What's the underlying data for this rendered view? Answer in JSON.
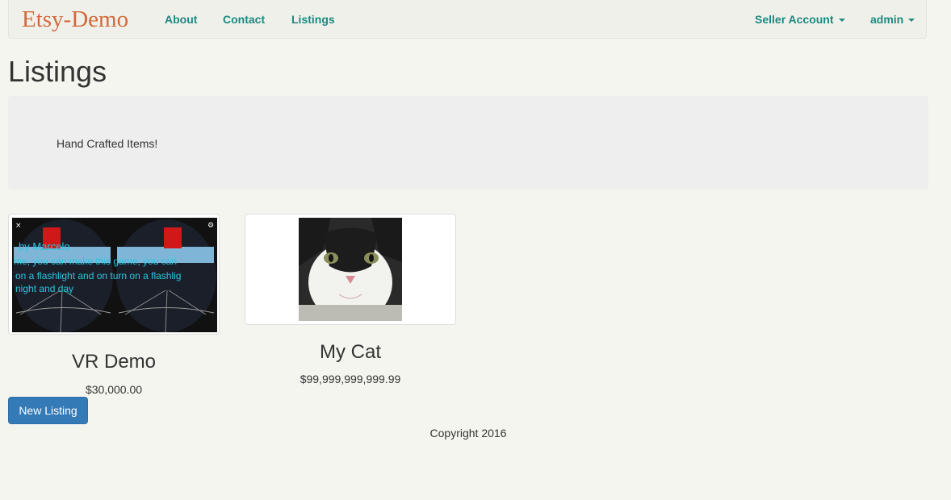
{
  "navbar": {
    "brand": "Etsy-Demo",
    "links": [
      "About",
      "Contact",
      "Listings"
    ],
    "seller_account": "Seller Account",
    "user": "admin"
  },
  "page": {
    "title": "Listings",
    "tagline": "Hand Crafted Items!"
  },
  "listings": [
    {
      "title": "VR Demo",
      "price": "$30,000.00",
      "image_text": [
        "by Marcelo",
        "me, you can make this game, you can",
        "on a flashlight and on turn on a flashlig",
        "night and day"
      ]
    },
    {
      "title": "My Cat",
      "price": "$99,999,999,999.99"
    }
  ],
  "new_listing_label": "New Listing",
  "footer": "Copyright 2016",
  "colors": {
    "brand": "#d3693b",
    "nav_link": "#1a8a80",
    "primary_button": "#337ab7",
    "background": "#f5f5f0"
  }
}
